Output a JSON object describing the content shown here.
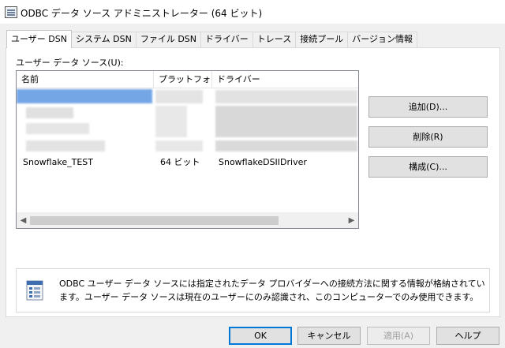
{
  "window": {
    "title": "ODBC データ ソース アドミニストレーター (64 ビット)"
  },
  "tabs": [
    {
      "label": "ユーザー DSN",
      "active": true
    },
    {
      "label": "システム DSN"
    },
    {
      "label": "ファイル DSN"
    },
    {
      "label": "ドライバー"
    },
    {
      "label": "トレース"
    },
    {
      "label": "接続プール"
    },
    {
      "label": "バージョン情報"
    }
  ],
  "list": {
    "label": "ユーザー データ ソース(U):",
    "columns": [
      "名前",
      "プラットフォーム",
      "ドライバー"
    ],
    "visible_row": {
      "name": "Snowflake_TEST",
      "platform": "64 ビット",
      "driver": "SnowflakeDSIIDriver"
    }
  },
  "side_buttons": {
    "add": "追加(D)...",
    "remove": "削除(R)",
    "configure": "構成(C)..."
  },
  "info": {
    "text": "ODBC ユーザー データ ソースには指定されたデータ プロバイダーへの接続方法に関する情報が格納されています。ユーザー データ ソースは現在のユーザーにのみ認識され、このコンピューターでのみ使用できます。"
  },
  "footer": {
    "ok": "OK",
    "cancel": "キャンセル",
    "apply": "適用(A)",
    "help": "ヘルプ"
  }
}
